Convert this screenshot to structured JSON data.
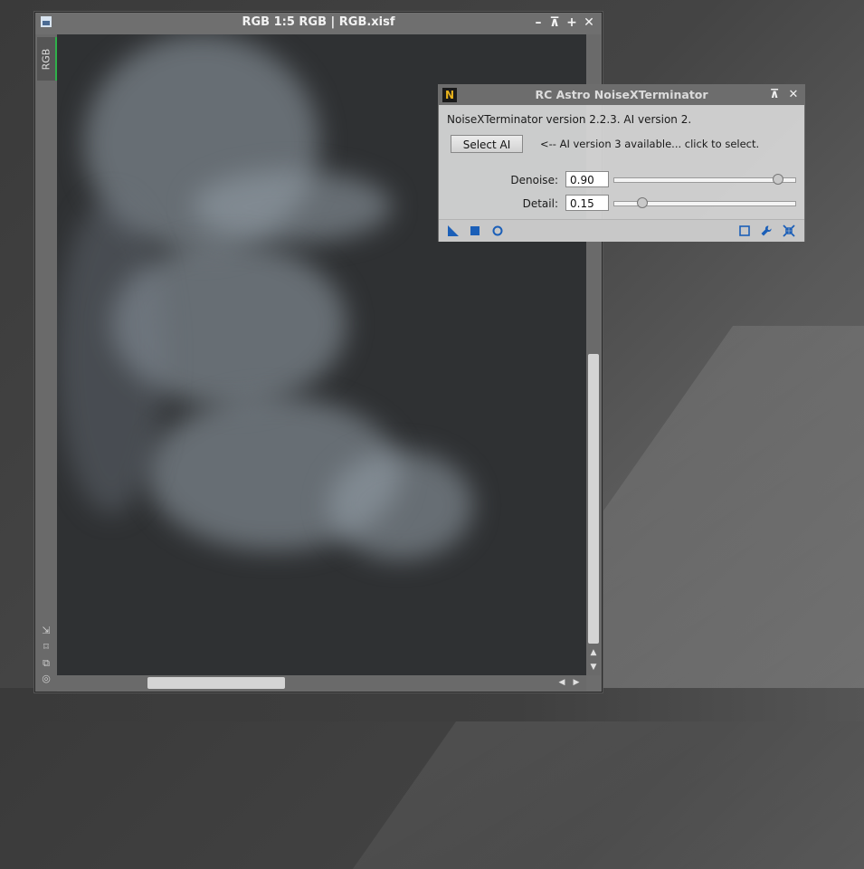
{
  "image_window": {
    "title": "RGB 1:5 RGB | RGB.xisf",
    "tab_label": "RGB",
    "buttons": [
      "minimize-icon",
      "shade-icon",
      "maximize-icon",
      "close-icon"
    ]
  },
  "dialog": {
    "title": "RC Astro NoiseXTerminator",
    "logo_letter": "N",
    "version_line": "NoiseXTerminator version 2.2.3. AI version 2.",
    "select_button": "Select AI",
    "hint": "<-- AI version 3 available... click to select.",
    "params": [
      {
        "label": "Denoise:",
        "value": "0.90",
        "fraction": 0.9
      },
      {
        "label": "Detail:",
        "value": "0.15",
        "fraction": 0.15
      }
    ],
    "footer_icons": [
      "new-instance-icon",
      "apply-icon",
      "apply-global-icon",
      "preview-icon",
      "settings-icon",
      "reset-icon"
    ]
  },
  "colors": {
    "accent": "#2fb04a",
    "icon_blue": "#1b5fb8",
    "logo_yellow": "#e8b21c"
  }
}
